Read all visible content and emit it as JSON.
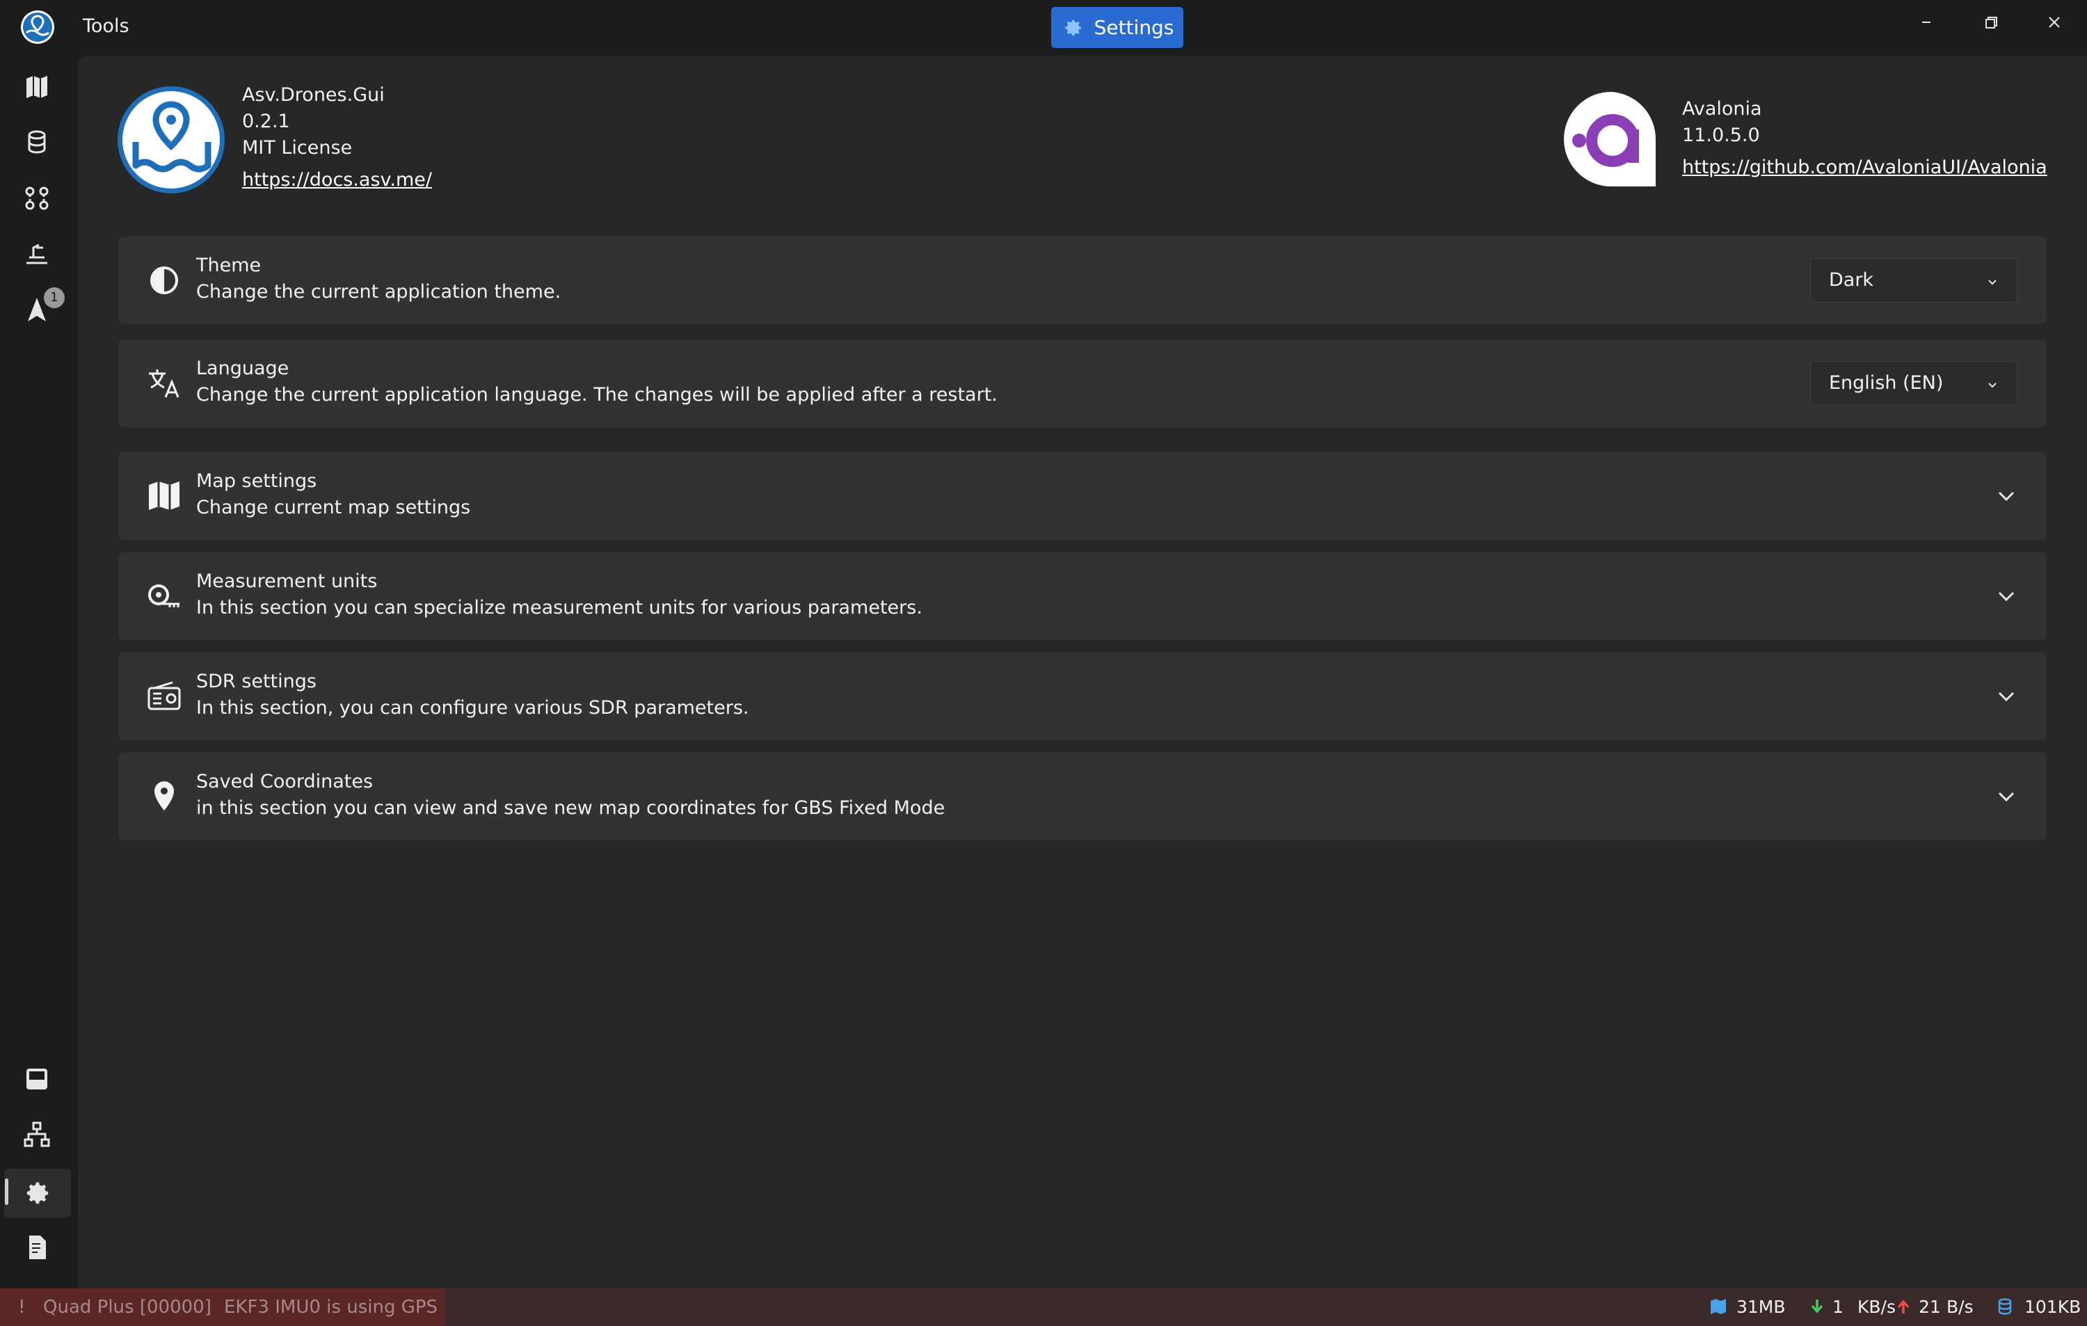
{
  "titlebar": {
    "title": "Tools",
    "settings_button": "Settings",
    "controls": [
      "minimize-icon",
      "restore-icon",
      "close-icon"
    ]
  },
  "rail": {
    "top_items": [
      "map-icon",
      "database-icon",
      "route-icon",
      "tool-icon",
      "navigation-arrow-icon"
    ],
    "badge": "1",
    "bottom_items": [
      "storage-icon",
      "network-icon",
      "gear-icon",
      "document-icon"
    ],
    "active": "gear-icon"
  },
  "about": {
    "app": {
      "name": "Asv.Drones.Gui",
      "version": "0.2.1",
      "license": "MIT License",
      "link": "https://docs.asv.me/"
    },
    "framework": {
      "name": "Avalonia",
      "version": "11.0.5.0",
      "link": "https://github.com/AvaloniaUI/Avalonia"
    }
  },
  "settings": {
    "theme": {
      "title": "Theme",
      "description": "Change the current application theme.",
      "value": "Dark"
    },
    "language": {
      "title": "Language",
      "description": "Change the current application language. The changes will be applied after a restart.",
      "value": "English (EN)"
    },
    "map": {
      "title": "Map settings",
      "description": "Change current map settings"
    },
    "units": {
      "title": "Measurement units",
      "description": "In this section you can specialize measurement units for various parameters."
    },
    "sdr": {
      "title": "SDR settings",
      "description": "In this section, you can configure various SDR parameters."
    },
    "coords": {
      "title": "Saved Coordinates",
      "description": "in this section you can view and save new map coordinates for GBS Fixed Mode"
    }
  },
  "status": {
    "alert_mark": "!",
    "device": "Quad Plus [00000]",
    "message": "EKF3 IMU0 is using GPS",
    "map_cache": "31MB",
    "rx_value": "1",
    "rx_unit": "KB/s",
    "tx_value": "21",
    "tx_unit": "B/s",
    "db_size": "101KB"
  },
  "colors": {
    "accent": "#2a6bd1",
    "background": "#1c1c1c",
    "content": "#272727",
    "card": "#323232",
    "alert": "#5a2626",
    "avalonia": "#8b3fb7"
  }
}
